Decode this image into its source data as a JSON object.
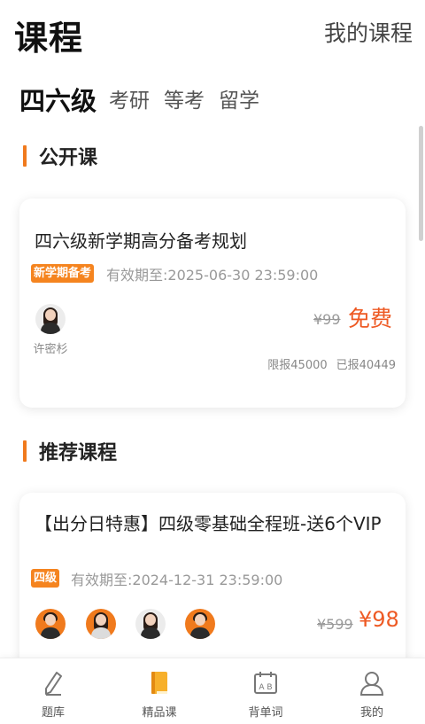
{
  "header": {
    "title": "课程",
    "my_courses": "我的课程"
  },
  "tabs": [
    {
      "label": "四六级",
      "active": true
    },
    {
      "label": "考研",
      "active": false
    },
    {
      "label": "等考",
      "active": false
    },
    {
      "label": "留学",
      "active": false
    }
  ],
  "sections": {
    "open": {
      "title": "公开课"
    },
    "recommended": {
      "title": "推荐课程"
    }
  },
  "open_course": {
    "title": "四六级新学期高分备考规划",
    "tag": "新学期备考",
    "validity": "有效期至:2025-06-30 23:59:00",
    "teachers": [
      {
        "name": "许密杉"
      }
    ],
    "original_price": "¥99",
    "price": "免费",
    "quota": "限报45000",
    "enrolled": "已报40449"
  },
  "recommended_course": {
    "title": "【出分日特惠】四级零基础全程班-送6个VIP",
    "tag": "四级",
    "validity": "有效期至:2024-12-31 23:59:00",
    "teachers": [
      {
        "name": ""
      },
      {
        "name": ""
      },
      {
        "name": ""
      },
      {
        "name": ""
      }
    ],
    "original_price": "¥599",
    "price": "¥98"
  },
  "bottom_nav": [
    {
      "label": "题库",
      "icon": "pencil-icon",
      "active": false
    },
    {
      "label": "精品课",
      "icon": "book-icon",
      "active": true
    },
    {
      "label": "背单词",
      "icon": "calendar-icon",
      "active": false
    },
    {
      "label": "我的",
      "icon": "profile-icon",
      "active": false
    }
  ],
  "colors": {
    "accent": "#f07a1d",
    "price": "#ee5a24",
    "tag": "#f5841f"
  }
}
